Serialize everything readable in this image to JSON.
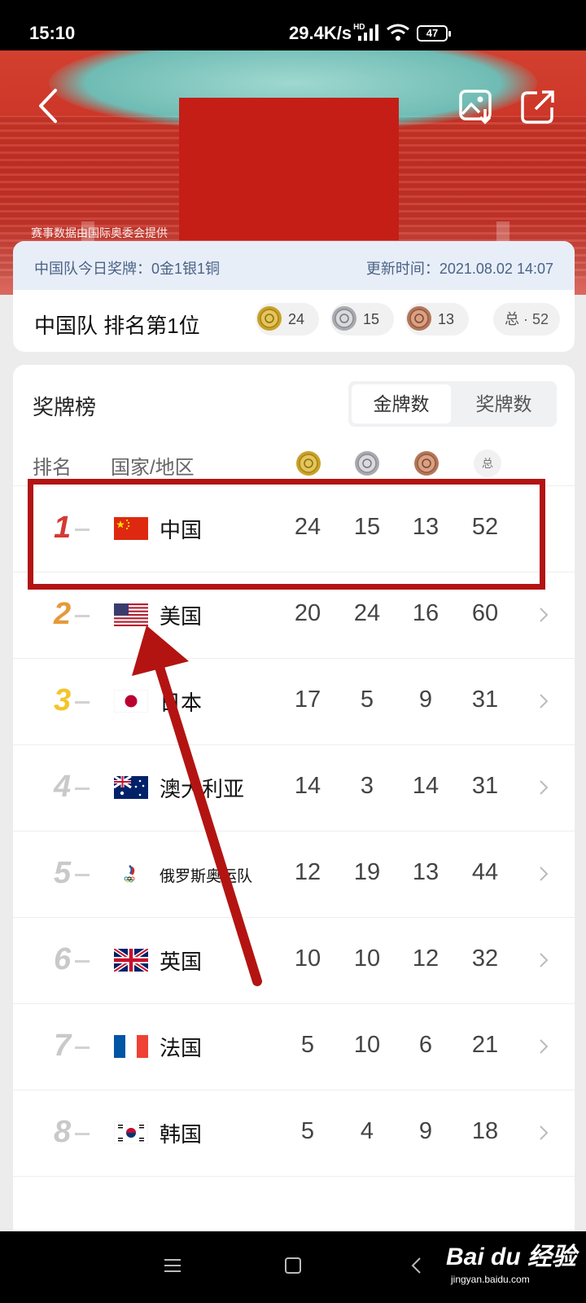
{
  "status_bar": {
    "time": "15:10",
    "net_speed": "29.4K/s",
    "net_tag": "HD",
    "battery": "47"
  },
  "header": {
    "data_provider": "赛事数据由国际奥委会提供"
  },
  "summary": {
    "today_medals": "中国队今日奖牌：0金1银1铜",
    "update_time": "更新时间：2021.08.02 14:07",
    "team_rank": "中国队 排名第1位",
    "gold": "24",
    "silver": "15",
    "bronze": "13",
    "total": "总 · 52"
  },
  "board": {
    "title": "奖牌榜",
    "tabs": [
      "金牌数",
      "奖牌数"
    ],
    "active_tab": 0,
    "col_rank": "排名",
    "col_country": "国家/地区",
    "col_total": "总",
    "rows": [
      {
        "rank": "1",
        "country": "中国",
        "flag": "china-flag-icon",
        "gold": "24",
        "silver": "15",
        "bronze": "13",
        "total": "52"
      },
      {
        "rank": "2",
        "country": "美国",
        "flag": "usa-flag-icon",
        "gold": "20",
        "silver": "24",
        "bronze": "16",
        "total": "60"
      },
      {
        "rank": "3",
        "country": "日本",
        "flag": "japan-flag-icon",
        "gold": "17",
        "silver": "5",
        "bronze": "9",
        "total": "31"
      },
      {
        "rank": "4",
        "country": "澳大利亚",
        "flag": "australia-flag-icon",
        "gold": "14",
        "silver": "3",
        "bronze": "14",
        "total": "31"
      },
      {
        "rank": "5",
        "country": "俄罗斯奥运队",
        "flag": "roc-emblem-icon",
        "gold": "12",
        "silver": "19",
        "bronze": "13",
        "total": "44"
      },
      {
        "rank": "6",
        "country": "英国",
        "flag": "uk-flag-icon",
        "gold": "10",
        "silver": "10",
        "bronze": "12",
        "total": "32"
      },
      {
        "rank": "7",
        "country": "法国",
        "flag": "france-flag-icon",
        "gold": "5",
        "silver": "10",
        "bronze": "6",
        "total": "21"
      },
      {
        "rank": "8",
        "country": "韩国",
        "flag": "korea-flag-icon",
        "gold": "5",
        "silver": "4",
        "bronze": "9",
        "total": "18"
      }
    ]
  },
  "colors": {
    "rank1": "#d23b33",
    "rank2": "#e59a3b",
    "rank3": "#f2c52a",
    "other_rank": "#c9c9c9",
    "annotation": "#b31412"
  },
  "watermark": {
    "brand": "Bai du 经验",
    "url": "jingyan.baidu.com"
  }
}
